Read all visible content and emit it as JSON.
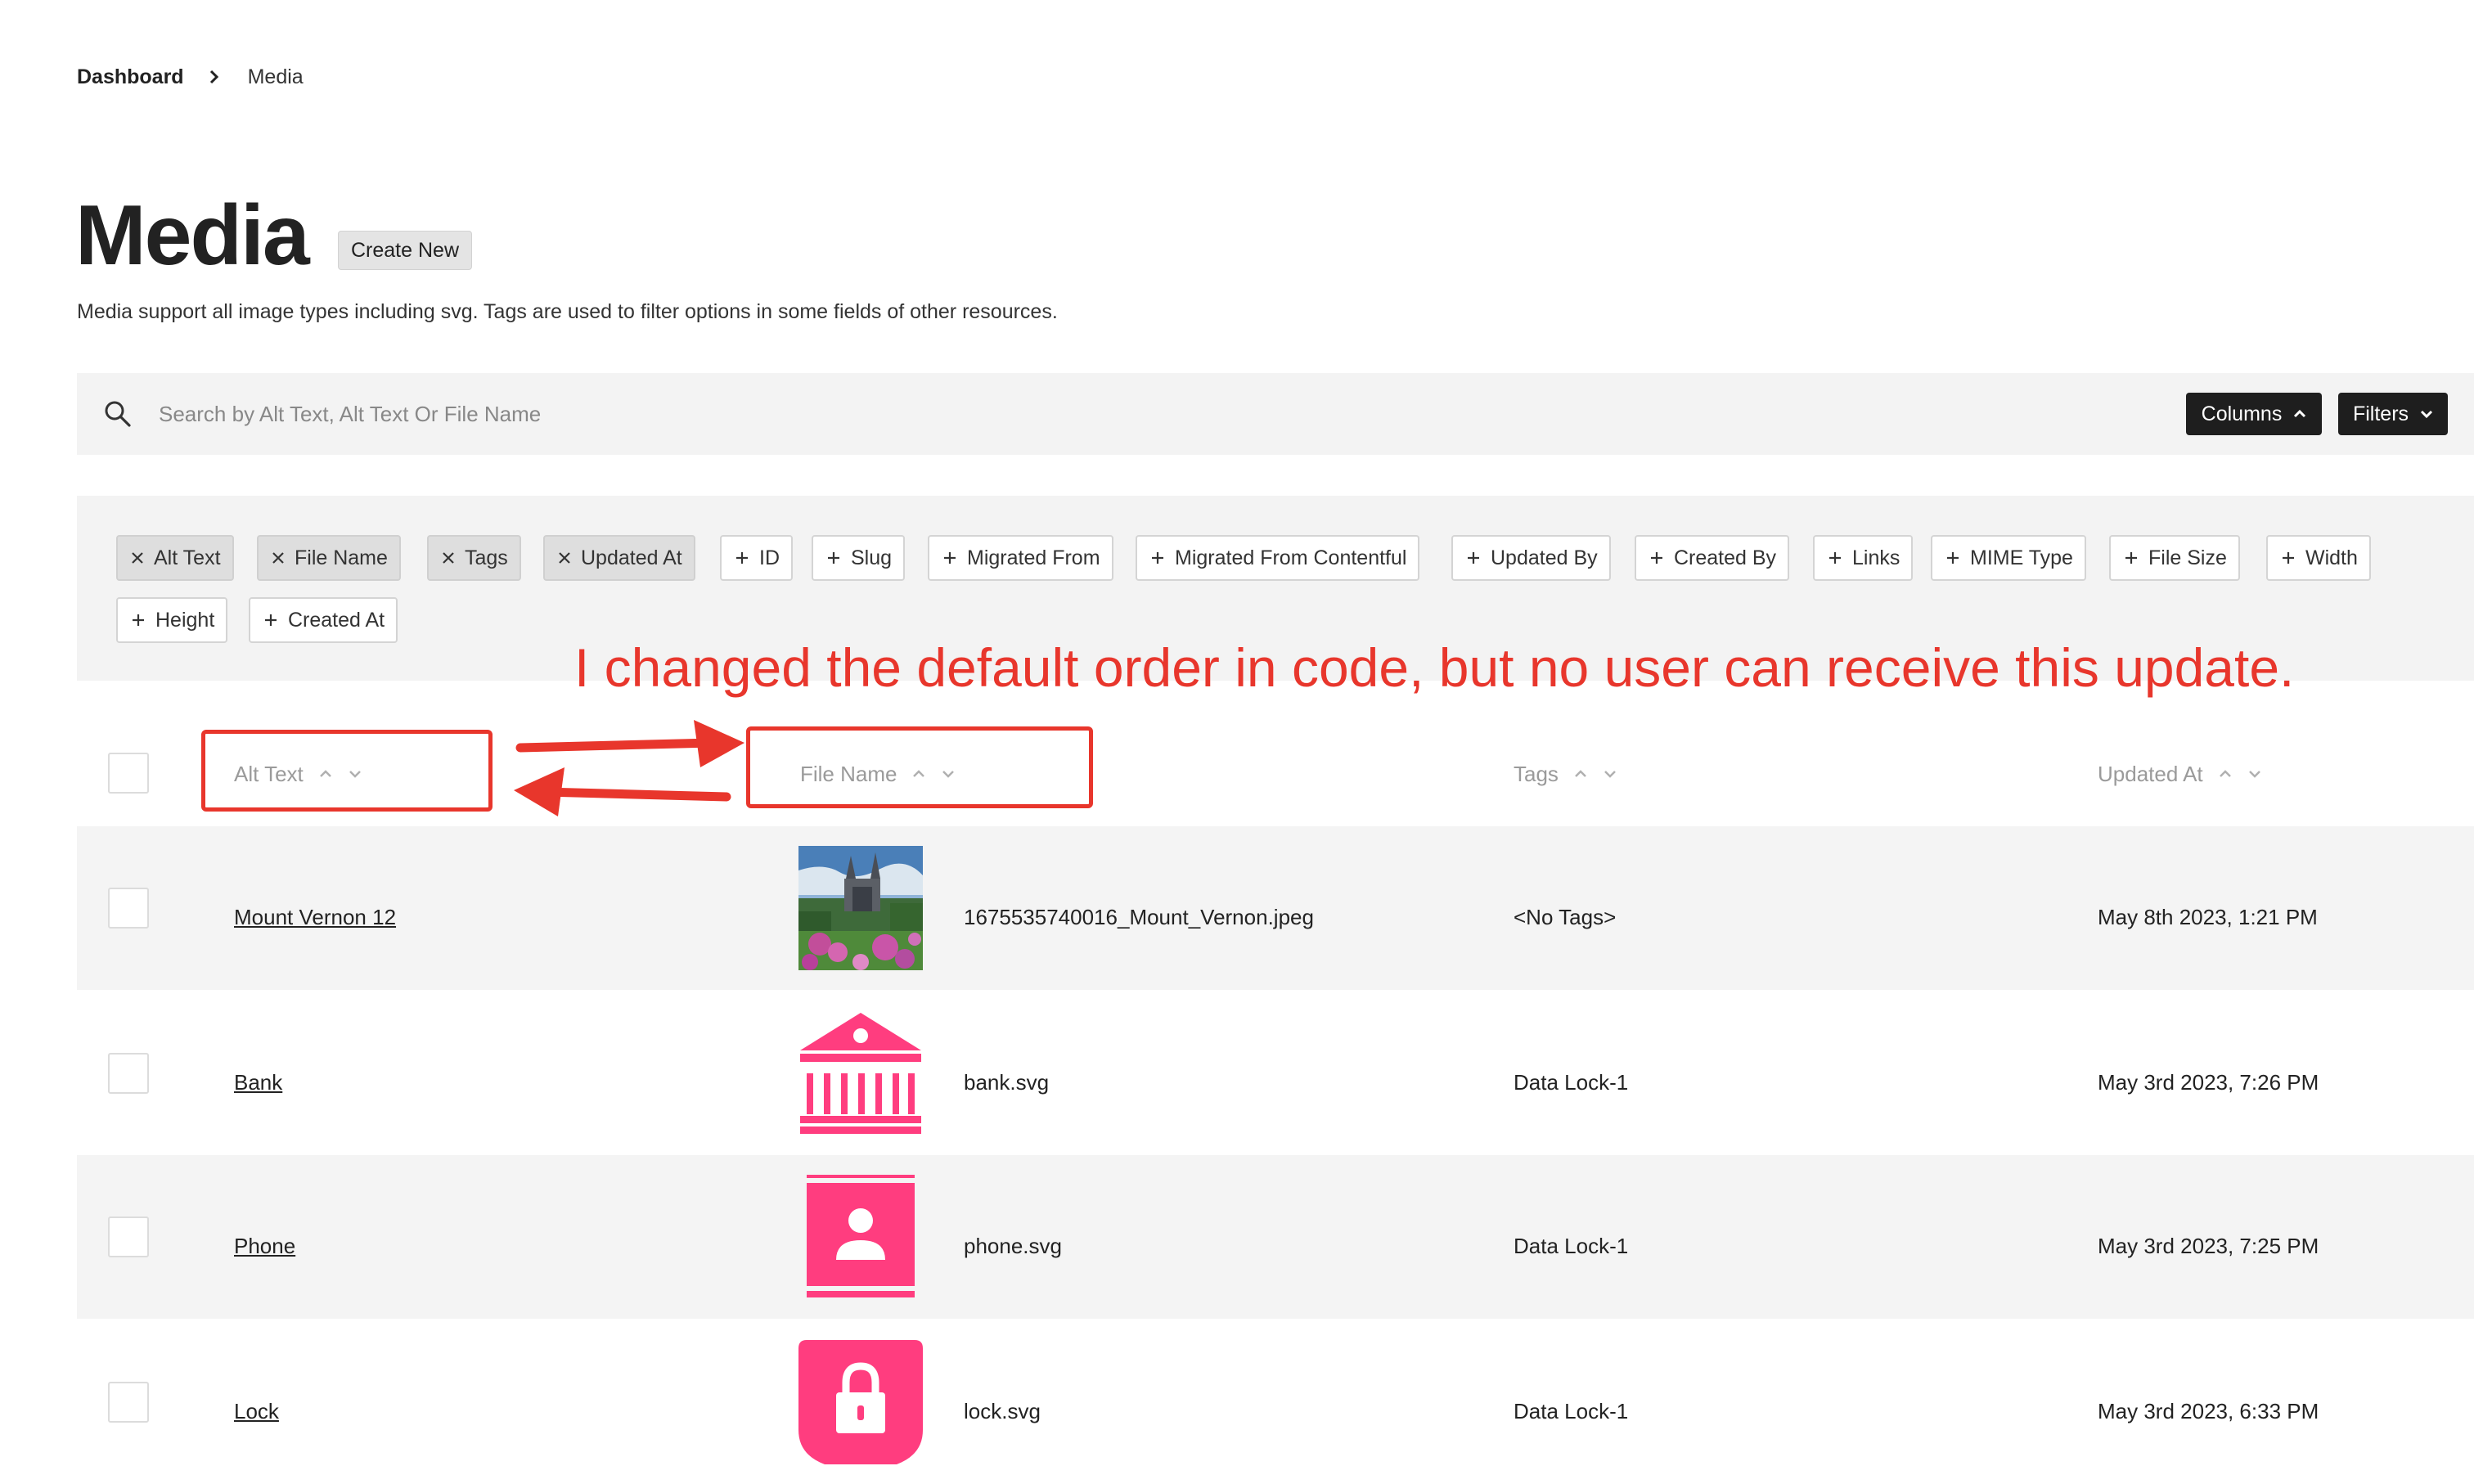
{
  "breadcrumb": {
    "items": [
      "Dashboard",
      "Media"
    ]
  },
  "page": {
    "title": "Media",
    "create_label": "Create New",
    "description": "Media support all image types including svg. Tags are used to filter options in some fields of other resources."
  },
  "search": {
    "placeholder": "Search by Alt Text, Alt Text Or File Name",
    "value": ""
  },
  "toolbar": {
    "columns_label": "Columns",
    "filters_label": "Filters"
  },
  "columns_panel": {
    "active": [
      "Alt Text",
      "File Name",
      "Tags",
      "Updated At"
    ],
    "available": [
      "ID",
      "Slug",
      "Migrated From",
      "Migrated From Contentful",
      "Updated By",
      "Created By",
      "Links",
      "MIME Type",
      "File Size",
      "Width",
      "Height",
      "Created At"
    ]
  },
  "annotation": {
    "text": "I changed the default order in code, but no user can receive this update.",
    "color": "#e8362c"
  },
  "table": {
    "headers": [
      "Alt Text",
      "File Name",
      "Tags",
      "Updated At"
    ],
    "rows": [
      {
        "alt": "Mount Vernon 12",
        "thumb": "photo",
        "file": "1675535740016_Mount_Vernon.jpeg",
        "tags": "<No Tags>",
        "updated": "May 8th 2023, 1:21 PM"
      },
      {
        "alt": "Bank",
        "thumb": "bank-icon",
        "file": "bank.svg",
        "tags": "Data Lock-1",
        "updated": "May 3rd 2023, 7:26 PM"
      },
      {
        "alt": "Phone",
        "thumb": "phone-icon",
        "file": "phone.svg",
        "tags": "Data Lock-1",
        "updated": "May 3rd 2023, 7:25 PM"
      },
      {
        "alt": "Lock",
        "thumb": "lock-icon",
        "file": "lock.svg",
        "tags": "Data Lock-1",
        "updated": "May 3rd 2023, 6:33 PM"
      }
    ]
  },
  "colors": {
    "brand_pink": "#ff3d7f",
    "annotation_red": "#e8362c",
    "dark_button": "#1e1e1e"
  }
}
